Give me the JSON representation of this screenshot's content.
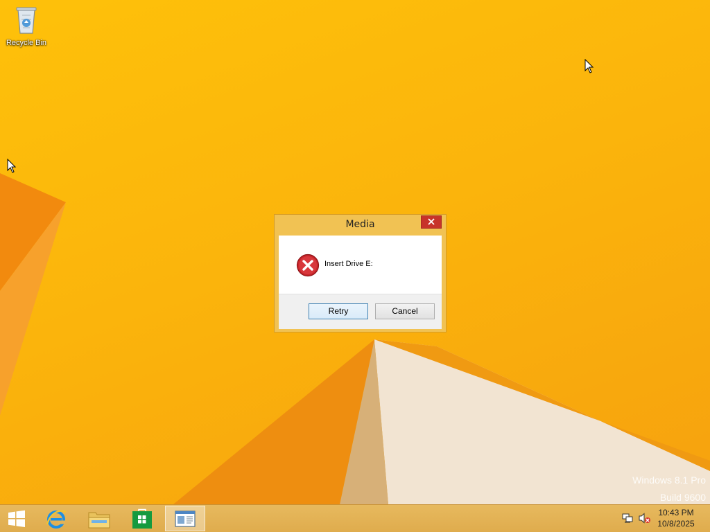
{
  "desktop": {
    "icons": [
      {
        "label": "Recycle Bin",
        "icon": "recycle-bin-icon"
      }
    ],
    "watermark": {
      "line1": "Windows 8.1 Pro",
      "line2": "Build 9600"
    }
  },
  "dialog": {
    "title": "Media",
    "message": "Insert Drive E:",
    "icon": "error-icon",
    "buttons": {
      "retry": "Retry",
      "cancel": "Cancel"
    }
  },
  "taskbar": {
    "pinned": [
      "start-icon",
      "internet-explorer-icon",
      "file-explorer-icon",
      "store-icon",
      "app-window-icon"
    ],
    "tray": {
      "network": "network-icon",
      "volume": "volume-muted-icon"
    },
    "clock": {
      "time": "10:43 PM",
      "date": "10/8/2025"
    }
  },
  "colors": {
    "wallpaper": "#fbb40c",
    "taskbar": "#e3b356",
    "dialog_frame": "#f1c253",
    "close_button": "#c7332a"
  }
}
